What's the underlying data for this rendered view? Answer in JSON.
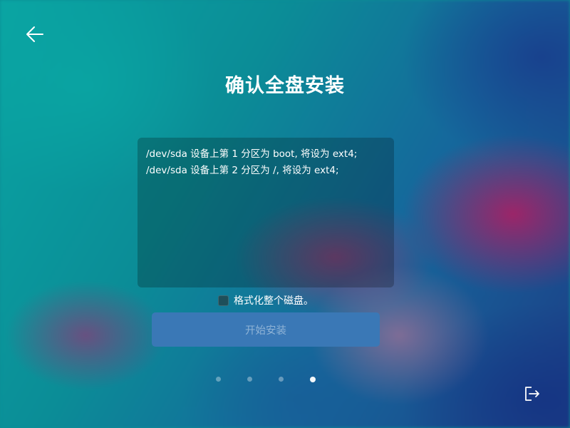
{
  "header": {
    "back_icon": "arrow-left-icon",
    "title": "确认全盘安装"
  },
  "summary": {
    "lines": [
      "/dev/sda 设备上第 1 分区为 boot, 将设为 ext4;",
      "/dev/sda 设备上第 2 分区为 /, 将设为 ext4;"
    ]
  },
  "options": {
    "format_disk_label": "格式化整个磁盘。",
    "format_disk_checked": false
  },
  "actions": {
    "install_label": "开始安装",
    "install_enabled": false
  },
  "pager": {
    "total": 4,
    "current": 4
  },
  "footer": {
    "exit_icon": "exit-icon"
  },
  "colors": {
    "button_bg": "#3a78b6",
    "button_text_disabled": "#8fb3d6",
    "text": "#ffffff"
  }
}
